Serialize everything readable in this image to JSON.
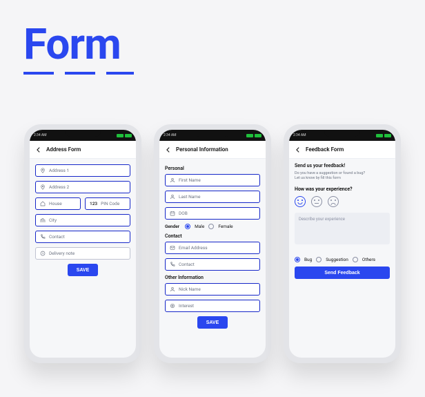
{
  "hero": "Form",
  "status_time": "2:34 AM",
  "accent": "#2a47ef",
  "phone1": {
    "title": "Address Form",
    "fields": {
      "addr1": "Address 1",
      "addr2": "Address 2",
      "house": "House",
      "pin": "PIN Code",
      "pin_prefix": "123",
      "city": "City",
      "contact": "Contact",
      "note": "Delivery note"
    },
    "save": "SAVE"
  },
  "phone2": {
    "title": "Personal Information",
    "sections": {
      "personal": "Personal",
      "contact": "Contact",
      "other": "Other Information"
    },
    "fields": {
      "first": "First Name",
      "last": "Last Name",
      "dob": "DOB",
      "email": "Email Address",
      "contact": "Contact",
      "nick": "Nick Name",
      "interest": "Interest"
    },
    "gender": {
      "label": "Gender",
      "male": "Male",
      "female": "Female",
      "selected": "male"
    },
    "save": "SAVE"
  },
  "phone3": {
    "title": "Feedback Form",
    "headline": "Send us your feedback!",
    "sub1": "Do you have a suggestion or found a bug?",
    "sub2": "Let us know by fill this form",
    "question": "How was your experience?",
    "experience_selected": "happy",
    "textarea_ph": "Describe your experience",
    "type": {
      "bug": "Bug",
      "suggestion": "Suggestion",
      "others": "Others",
      "selected": "bug"
    },
    "submit": "Send Feedback"
  }
}
